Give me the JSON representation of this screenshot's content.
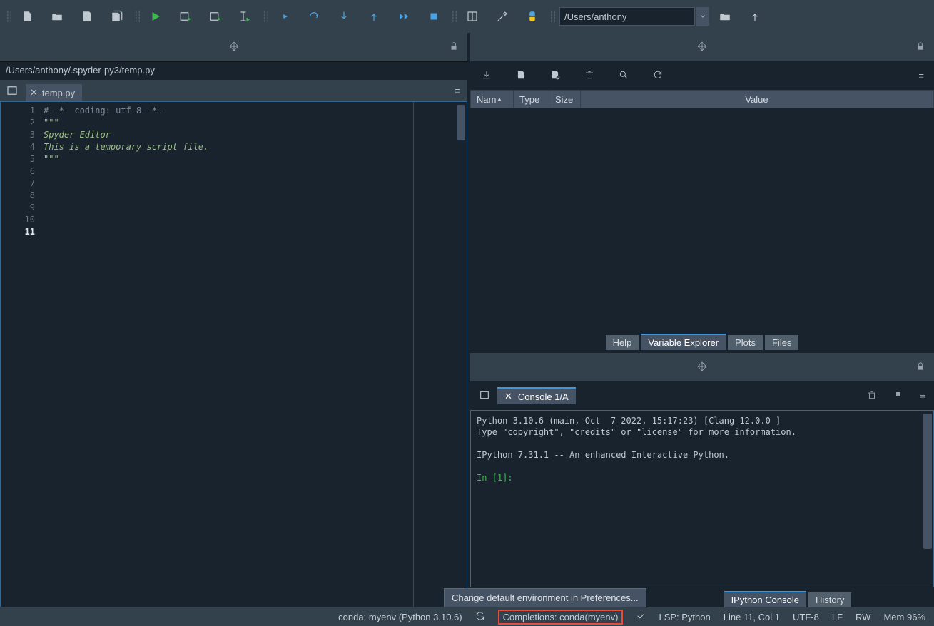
{
  "toolbar": {
    "path_value": "/Users/anthony"
  },
  "editor": {
    "file_path": "/Users/anthony/.spyder-py3/temp.py",
    "tab_label": "temp.py",
    "lines": [
      {
        "n": "1",
        "cls": "c-comment",
        "text": "# -*- coding: utf-8 -*-"
      },
      {
        "n": "2",
        "cls": "c-doc",
        "text": "\"\"\""
      },
      {
        "n": "3",
        "cls": "c-doc",
        "text": "Spyder Editor"
      },
      {
        "n": "4",
        "cls": "c-doc",
        "text": ""
      },
      {
        "n": "5",
        "cls": "c-doc",
        "text": "This is a temporary script file."
      },
      {
        "n": "6",
        "cls": "c-doc",
        "text": "\"\"\""
      },
      {
        "n": "7",
        "cls": "",
        "text": ""
      },
      {
        "n": "8",
        "cls": "",
        "text": ""
      },
      {
        "n": "9",
        "cls": "",
        "text": ""
      },
      {
        "n": "10",
        "cls": "",
        "text": ""
      },
      {
        "n": "11",
        "cls": "",
        "text": ""
      }
    ],
    "current_line": 11
  },
  "variable_explorer": {
    "columns": {
      "name": "Nam",
      "type": "Type",
      "size": "Size",
      "value": "Value"
    },
    "tabs": [
      "Help",
      "Variable Explorer",
      "Plots",
      "Files"
    ],
    "active_tab": 1
  },
  "console": {
    "tab_label": "Console 1/A",
    "output_line1": "Python 3.10.6 (main, Oct  7 2022, 15:17:23) [Clang 12.0.0 ]",
    "output_line2": "Type \"copyright\", \"credits\" or \"license\" for more information.",
    "output_line3": "",
    "output_line4": "IPython 7.31.1 -- An enhanced Interactive Python.",
    "output_line5": "",
    "prompt": "In [1]: ",
    "tabs": [
      "IPython Console",
      "History"
    ],
    "active_tab": 0
  },
  "tooltip": "Change default environment in Preferences...",
  "statusbar": {
    "env": "conda: myenv (Python 3.10.6)",
    "completions": "Completions: conda(myenv)",
    "lsp": "LSP: Python",
    "position": "Line 11, Col 1",
    "encoding": "UTF-8",
    "eol": "LF",
    "rw": "RW",
    "mem": "Mem 96%"
  }
}
